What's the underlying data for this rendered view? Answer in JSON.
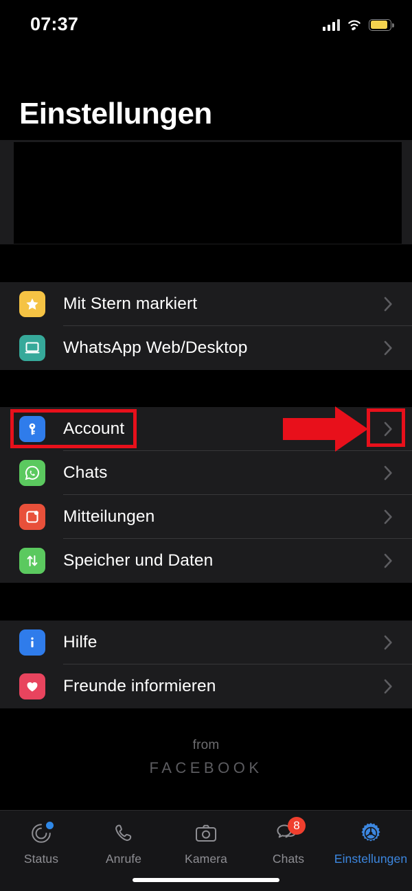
{
  "statusbar": {
    "time": "07:37",
    "signal_icon": "cellular-signal-icon",
    "wifi_icon": "wifi-icon",
    "battery_icon": "battery-icon"
  },
  "header": {
    "title": "Einstellungen"
  },
  "profile": {
    "redacted": true,
    "redaction_color": "#000000"
  },
  "sections": [
    {
      "name": "shortcuts",
      "rows": [
        {
          "label": "Mit Stern markiert",
          "icon": "star-icon",
          "icon_bg": "#f5c344",
          "chevron": "chevron-right-icon"
        },
        {
          "label": "WhatsApp Web/Desktop",
          "icon": "laptop-icon",
          "icon_bg": "#36a99a",
          "chevron": "chevron-right-icon"
        }
      ]
    },
    {
      "name": "preferences",
      "rows": [
        {
          "label": "Account",
          "icon": "key-icon",
          "icon_bg": "#2f7ceb",
          "chevron": "chevron-right-icon"
        },
        {
          "label": "Chats",
          "icon": "whatsapp-bubble-icon",
          "icon_bg": "#5bc95f",
          "chevron": "chevron-right-icon"
        },
        {
          "label": "Mitteilungen",
          "icon": "notification-icon",
          "icon_bg": "#e8503a",
          "chevron": "chevron-right-icon"
        },
        {
          "label": "Speicher und Daten",
          "icon": "data-arrows-icon",
          "icon_bg": "#5bc95f",
          "chevron": "chevron-right-icon"
        }
      ]
    },
    {
      "name": "support",
      "rows": [
        {
          "label": "Hilfe",
          "icon": "info-icon",
          "icon_bg": "#2f7ceb",
          "chevron": "chevron-right-icon"
        },
        {
          "label": "Freunde informieren",
          "icon": "heart-icon",
          "icon_bg": "#e8445e",
          "chevron": "chevron-right-icon"
        }
      ]
    }
  ],
  "footer": {
    "from": "from",
    "brand": "FACEBOOK"
  },
  "tabbar": {
    "items": [
      {
        "label": "Status",
        "icon": "status-rings-icon",
        "badge": "",
        "active": false,
        "dot": true
      },
      {
        "label": "Anrufe",
        "icon": "phone-icon",
        "badge": "",
        "active": false,
        "dot": false
      },
      {
        "label": "Kamera",
        "icon": "camera-icon",
        "badge": "",
        "active": false,
        "dot": false
      },
      {
        "label": "Chats",
        "icon": "chat-bubbles-icon",
        "badge": "8",
        "active": false,
        "dot": false
      },
      {
        "label": "Einstellungen",
        "icon": "gear-icon",
        "badge": "",
        "active": true,
        "dot": false
      }
    ],
    "active_color": "#3c87e0",
    "badge_color": "#f03f2e"
  },
  "annotations": {
    "highlight_color": "#e8101b",
    "boxes": [
      {
        "name": "account-row-highlight",
        "target": "Account"
      },
      {
        "name": "account-chevron-highlight",
        "target": "chevron-right-icon"
      }
    ],
    "arrow": {
      "name": "pointer-arrow",
      "direction": "right"
    }
  }
}
